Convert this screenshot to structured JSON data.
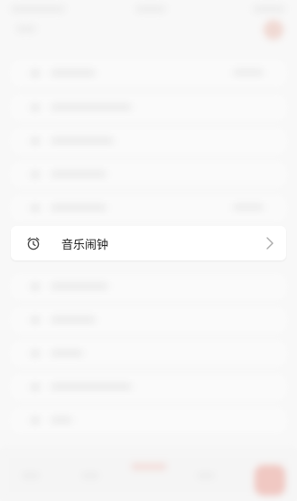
{
  "alarm_item": {
    "label": "音乐闹钟",
    "icon": "alarm-clock-icon",
    "chevron": "chevron-right-icon"
  },
  "colors": {
    "accent": "#e07060",
    "background": "#f4f4f4",
    "card": "#ffffff"
  }
}
